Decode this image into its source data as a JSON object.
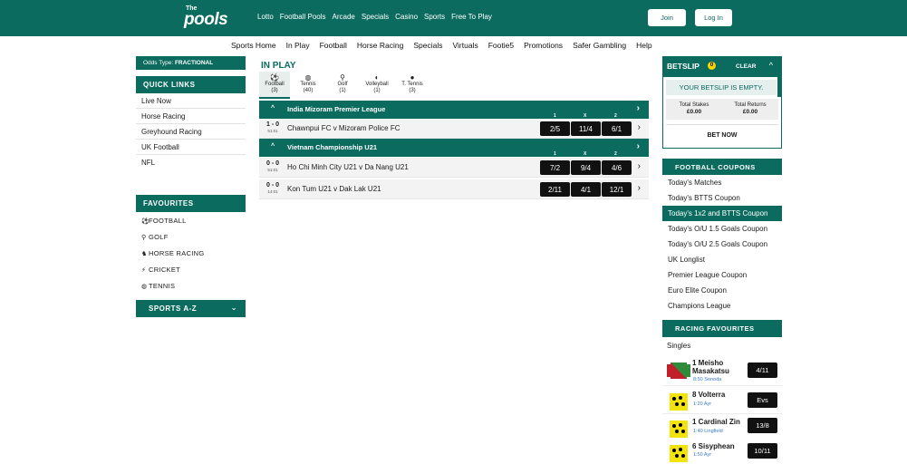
{
  "header": {
    "logo_the": "The",
    "logo_pools": "pools",
    "nav": [
      "Lotto",
      "Football Pools",
      "Arcade",
      "Specials",
      "Casino",
      "Sports",
      "Free To Play"
    ],
    "join_label": "Join",
    "login_label": "Log In"
  },
  "subnav": [
    "Sports Home",
    "In Play",
    "Football",
    "Horse Racing",
    "Specials",
    "Virtuals",
    "Footie5",
    "Promotions",
    "Safer Gambling",
    "Help"
  ],
  "left": {
    "odds_type_label": "Odds Type:",
    "odds_type_value": "FRACTIONAL",
    "quick_links_title": "QUICK LINKS",
    "quick_links": [
      "Live Now",
      "Horse Racing",
      "Greyhound Racing",
      "UK Football",
      "NFL"
    ],
    "favourites_title": "FAVOURITES",
    "favourites": [
      {
        "icon": "⚽",
        "label": "FOOTBALL"
      },
      {
        "icon": "⚲",
        "label": "GOLF"
      },
      {
        "icon": "♞",
        "label": "HORSE RACING"
      },
      {
        "icon": "⚡",
        "label": "CRICKET"
      },
      {
        "icon": "◍",
        "label": "TENNIS"
      }
    ],
    "sports_az": "SPORTS A-Z"
  },
  "inplay": {
    "title": "IN PLAY",
    "tabs": [
      {
        "icon": "⚽",
        "name": "Football",
        "count": "(3)"
      },
      {
        "icon": "◍",
        "name": "Tennis",
        "count": "(40)"
      },
      {
        "icon": "⚲",
        "name": "Golf",
        "count": "(1)"
      },
      {
        "icon": "◐",
        "name": "Volleyball",
        "count": "(1)"
      },
      {
        "icon": "●",
        "name": "T. Tennis",
        "count": "(3)"
      }
    ],
    "col_nums": [
      "1",
      "X",
      "2"
    ],
    "leagues": [
      {
        "name": "India Mizoram Premier League",
        "matches": [
          {
            "score": "1 - 0",
            "time": "51:01",
            "name": "Chawnpui FC v Mizoram Police FC",
            "odds": [
              "2/5",
              "11/4",
              "6/1"
            ]
          }
        ]
      },
      {
        "name": "Vietnam Championship U21",
        "matches": [
          {
            "score": "0 - 0",
            "time": "51:01",
            "name": "Ho Chi Minh City U21 v Da Nang U21",
            "odds": [
              "7/2",
              "9/4",
              "4/6"
            ]
          },
          {
            "score": "0 - 0",
            "time": "14:01",
            "name": "Kon Tum U21 v Dak Lak U21",
            "odds": [
              "2/11",
              "4/1",
              "12/1"
            ]
          }
        ]
      }
    ]
  },
  "betslip": {
    "title": "BETSLIP",
    "count": "0",
    "clear": "CLEAR",
    "empty": "YOUR BETSLIP IS EMPTY.",
    "total_stakes_label": "Total Stakes",
    "total_stakes": "£0.00",
    "total_returns_label": "Total Returns",
    "total_returns": "£0.00",
    "bet_now": "BET NOW"
  },
  "coupons": {
    "title": "FOOTBALL COUPONS",
    "items": [
      "Today's Matches",
      "Today's BTTS Coupon",
      "Today's 1x2 and BTTS Coupon",
      "Today's O/U 1.5 Goals Coupon",
      "Today's O/U 2.5 Goals Coupon",
      "UK Longlist",
      "Premier League Coupon",
      "Euro Elite Coupon",
      "Champions League"
    ],
    "selected_index": 2
  },
  "racing": {
    "title": "RACING FAVOURITES",
    "singles": "Singles",
    "runners": [
      {
        "name": "1 Meisho Masakatsu",
        "time": "8:50 Sonoda",
        "odds": "4/11",
        "silk": "green-red"
      },
      {
        "name": "8 Volterra",
        "time": "1:20 Ayr",
        "odds": "Evs",
        "silk": "yellow-dots"
      },
      {
        "name": "1 Cardinal Zin",
        "time": "1:40 Lingfield",
        "odds": "13/8",
        "silk": "yellow-dots"
      },
      {
        "name": "6 Sisyphean",
        "time": "1:50 Ayr",
        "odds": "10/11",
        "silk": "yellow-dots"
      }
    ]
  },
  "colors": {
    "brand": "#0b6b5f",
    "odds_bg": "#111111",
    "accent_yellow": "#f7d600"
  }
}
